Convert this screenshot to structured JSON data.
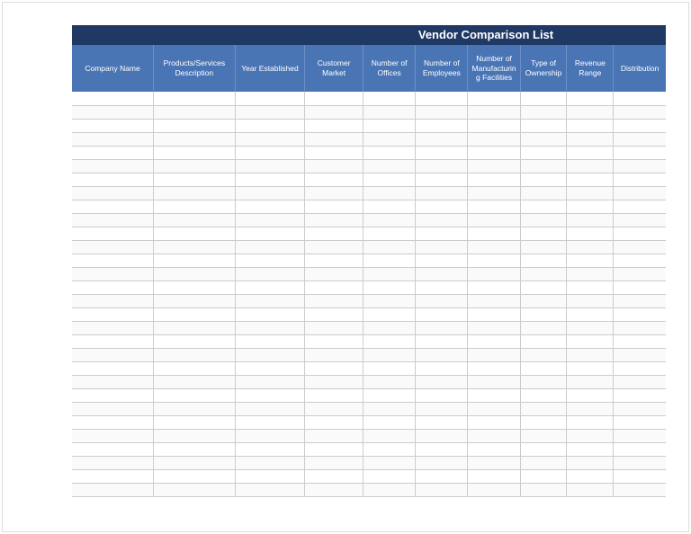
{
  "title": "Vendor Comparison List",
  "columns": [
    "Company Name",
    "Products/Services Description",
    "Year Established",
    "Customer Market",
    "Number of Offices",
    "Number of Employees",
    "Number of Manufacturing Facilities",
    "Type of Ownership",
    "Revenue Range",
    "Distribution"
  ],
  "rows": [
    [
      "",
      "",
      "",
      "",
      "",
      "",
      "",
      "",
      "",
      ""
    ],
    [
      "",
      "",
      "",
      "",
      "",
      "",
      "",
      "",
      "",
      ""
    ],
    [
      "",
      "",
      "",
      "",
      "",
      "",
      "",
      "",
      "",
      ""
    ],
    [
      "",
      "",
      "",
      "",
      "",
      "",
      "",
      "",
      "",
      ""
    ],
    [
      "",
      "",
      "",
      "",
      "",
      "",
      "",
      "",
      "",
      ""
    ],
    [
      "",
      "",
      "",
      "",
      "",
      "",
      "",
      "",
      "",
      ""
    ],
    [
      "",
      "",
      "",
      "",
      "",
      "",
      "",
      "",
      "",
      ""
    ],
    [
      "",
      "",
      "",
      "",
      "",
      "",
      "",
      "",
      "",
      ""
    ],
    [
      "",
      "",
      "",
      "",
      "",
      "",
      "",
      "",
      "",
      ""
    ],
    [
      "",
      "",
      "",
      "",
      "",
      "",
      "",
      "",
      "",
      ""
    ],
    [
      "",
      "",
      "",
      "",
      "",
      "",
      "",
      "",
      "",
      ""
    ],
    [
      "",
      "",
      "",
      "",
      "",
      "",
      "",
      "",
      "",
      ""
    ],
    [
      "",
      "",
      "",
      "",
      "",
      "",
      "",
      "",
      "",
      ""
    ],
    [
      "",
      "",
      "",
      "",
      "",
      "",
      "",
      "",
      "",
      ""
    ],
    [
      "",
      "",
      "",
      "",
      "",
      "",
      "",
      "",
      "",
      ""
    ],
    [
      "",
      "",
      "",
      "",
      "",
      "",
      "",
      "",
      "",
      ""
    ],
    [
      "",
      "",
      "",
      "",
      "",
      "",
      "",
      "",
      "",
      ""
    ],
    [
      "",
      "",
      "",
      "",
      "",
      "",
      "",
      "",
      "",
      ""
    ],
    [
      "",
      "",
      "",
      "",
      "",
      "",
      "",
      "",
      "",
      ""
    ],
    [
      "",
      "",
      "",
      "",
      "",
      "",
      "",
      "",
      "",
      ""
    ],
    [
      "",
      "",
      "",
      "",
      "",
      "",
      "",
      "",
      "",
      ""
    ],
    [
      "",
      "",
      "",
      "",
      "",
      "",
      "",
      "",
      "",
      ""
    ],
    [
      "",
      "",
      "",
      "",
      "",
      "",
      "",
      "",
      "",
      ""
    ],
    [
      "",
      "",
      "",
      "",
      "",
      "",
      "",
      "",
      "",
      ""
    ],
    [
      "",
      "",
      "",
      "",
      "",
      "",
      "",
      "",
      "",
      ""
    ],
    [
      "",
      "",
      "",
      "",
      "",
      "",
      "",
      "",
      "",
      ""
    ],
    [
      "",
      "",
      "",
      "",
      "",
      "",
      "",
      "",
      "",
      ""
    ],
    [
      "",
      "",
      "",
      "",
      "",
      "",
      "",
      "",
      "",
      ""
    ],
    [
      "",
      "",
      "",
      "",
      "",
      "",
      "",
      "",
      "",
      ""
    ],
    [
      "",
      "",
      "",
      "",
      "",
      "",
      "",
      "",
      "",
      ""
    ]
  ]
}
